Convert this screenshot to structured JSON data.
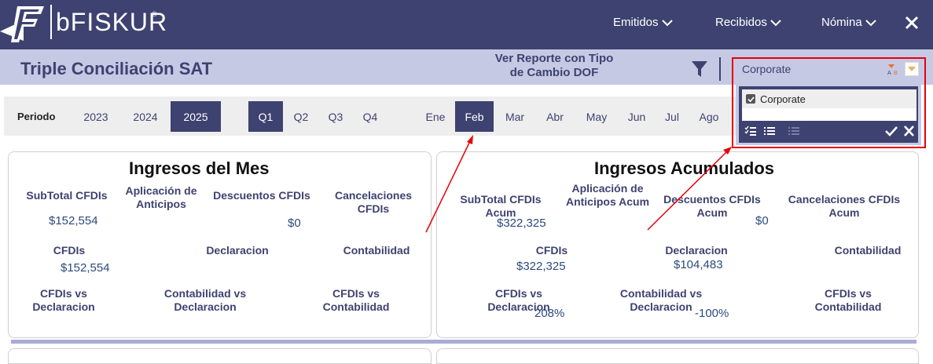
{
  "header": {
    "brand": "bFISKUR",
    "brand_mark": "®",
    "nav": [
      {
        "label": "Emitidos"
      },
      {
        "label": "Recibidos"
      },
      {
        "label": "Nómina"
      }
    ]
  },
  "title_bar": {
    "title": "Triple Conciliación SAT",
    "report_link_line1": "Ver Reporte con Tipo",
    "report_link_line2": "de Cambio DOF"
  },
  "filters": {
    "periodo_label": "Periodo",
    "years": [
      "2023",
      "2024",
      "2025"
    ],
    "selected_year": "2025",
    "quarters": [
      "Q1",
      "Q2",
      "Q3",
      "Q4"
    ],
    "selected_quarter": "Q1",
    "months": [
      "Ene",
      "Feb",
      "Mar",
      "Abr",
      "May",
      "Jun",
      "Jul",
      "Ago"
    ],
    "selected_month": "Feb"
  },
  "company_dropdown": {
    "selected": "Corporate",
    "options": [
      {
        "label": "Corporate",
        "checked": true
      }
    ]
  },
  "card_month": {
    "title": "Ingresos del Mes",
    "subtotal_label": "SubTotal CFDIs",
    "subtotal_value": "$152,554",
    "anticipos_label": "Aplicación de Anticipos",
    "descuentos_label": "Descuentos CFDIs",
    "descuentos_value": "$0",
    "cancelaciones_label": "Cancelaciones CFDIs",
    "cfdis_label": "CFDIs",
    "cfdis_value": "$152,554",
    "declaracion_label": "Declaracion",
    "contabilidad_label": "Contabilidad",
    "cfdis_vs_decl_label": "CFDIs vs Declaracion",
    "cont_vs_decl_label": "Contabilidad vs Declaracion",
    "cfdis_vs_cont_label": "CFDIs vs Contabilidad"
  },
  "card_acum": {
    "title": "Ingresos Acumulados",
    "subtotal_label": "SubTotal CFDIs Acum",
    "subtotal_value": "$322,325",
    "anticipos_label": "Aplicación de Anticipos Acum",
    "descuentos_label": "Descuentos CFDIs Acum",
    "descuentos_value": "$0",
    "cancelaciones_label": "Cancelaciones CFDIs Acum",
    "cfdis_label": "CFDIs",
    "cfdis_value": "$322,325",
    "declaracion_label": "Declaracion",
    "declaracion_value": "$104,483",
    "contabilidad_label": "Contabilidad",
    "cfdis_vs_decl_label": "CFDIs vs Declaracion",
    "cfdis_vs_decl_value": "208%",
    "cont_vs_decl_label": "Contabilidad vs Declaracion",
    "cont_vs_decl_value": "-100%",
    "cfdis_vs_cont_label": "CFDIs vs Contabilidad"
  },
  "colors": {
    "primary": "#3e4270",
    "title_bar": "#c5c9e4",
    "annotation": "#e8000b"
  }
}
